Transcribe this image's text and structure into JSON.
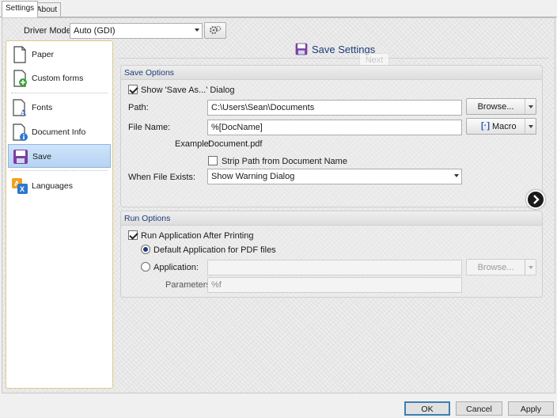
{
  "tabs": [
    {
      "label": "Settings"
    },
    {
      "label": "About"
    }
  ],
  "driver_mode": {
    "label": "Driver Mode:",
    "value": "Auto (GDI)"
  },
  "sidebar": {
    "items": [
      {
        "label": "Paper",
        "icon": "paper-icon"
      },
      {
        "label": "Custom forms",
        "icon": "custom-forms-icon"
      },
      {
        "label": "Fonts",
        "icon": "fonts-icon"
      },
      {
        "label": "Document Info",
        "icon": "document-info-icon"
      },
      {
        "label": "Save",
        "icon": "save-icon",
        "active": true
      },
      {
        "label": "Languages",
        "icon": "languages-icon"
      }
    ]
  },
  "header": {
    "title": "Save Settings",
    "next_ghost": "Next"
  },
  "save_options": {
    "title": "Save Options",
    "show_save_as": {
      "label": "Show 'Save As...' Dialog",
      "checked": true
    },
    "path": {
      "label": "Path:",
      "value": "C:\\Users\\Sean\\Documents",
      "browse": "Browse..."
    },
    "file_name": {
      "label": "File Name:",
      "value": "%[DocName]",
      "macro": "Macro"
    },
    "example": {
      "label": "Example:",
      "value": "Document.pdf"
    },
    "strip_path": {
      "label": "Strip Path from Document Name",
      "checked": false
    },
    "when_exists": {
      "label": "When File Exists:",
      "value": "Show Warning Dialog"
    }
  },
  "run_options": {
    "title": "Run Options",
    "run_after": {
      "label": "Run Application After Printing",
      "checked": true
    },
    "default_app": {
      "label": "Default Application for PDF files",
      "selected": true
    },
    "application": {
      "label": "Application:",
      "value": "",
      "browse": "Browse..."
    },
    "parameters": {
      "label": "Parameters:",
      "value": "%f"
    }
  },
  "footer": {
    "ok": "OK",
    "cancel": "Cancel",
    "apply": "Apply"
  },
  "colors": {
    "accent": "#1e3c78",
    "selection": "#cfe4fa",
    "sidebar_border": "#e1c889"
  }
}
